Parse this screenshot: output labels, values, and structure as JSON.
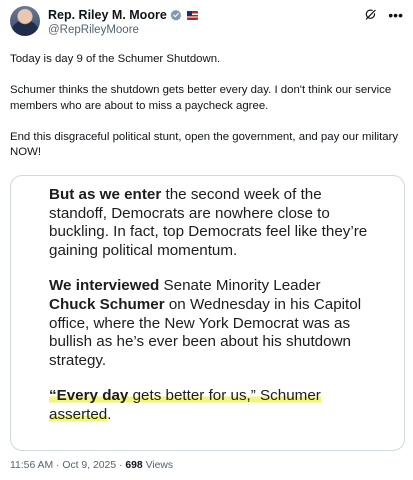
{
  "author": {
    "display_name": "Rep. Riley M. Moore",
    "handle": "@RepRileyMoore",
    "verified_badge_color": "#829aab",
    "flag_emoji": "🇺🇸"
  },
  "tweet": {
    "paragraphs": [
      "Today is day 9 of the Schumer Shutdown.",
      "Schumer thinks the shutdown gets better every day. I don't think our service members who are about to miss a paycheck agree.",
      "End this disgraceful political stunt, open the government, and pay our military NOW!"
    ]
  },
  "image": {
    "p1_lead": "But as we enter",
    "p1_rest": " the second week of the standoff, Democrats are nowhere close to buckling. In fact, top Democrats feel like they’re gaining political momentum.",
    "p2_lead": "We interviewed",
    "p2_mid": " Senate Minority Leader ",
    "p2_name": "Chuck Schumer",
    "p2_rest": " on Wednesday in his Capitol office, where the New York Democrat was as bullish as he’s ever been about his shutdown strategy.",
    "p3_lead": "“Every day",
    "p3_mid": " gets better for us,” Schumer",
    "p3_end": "asserted",
    "p3_period": ".",
    "highlight_color": "#f0f56e"
  },
  "footer": {
    "time": "11:56 AM",
    "sep1": " · ",
    "date": "Oct 9, 2025",
    "sep2": " · ",
    "views": "698",
    "views_label": " Views"
  }
}
